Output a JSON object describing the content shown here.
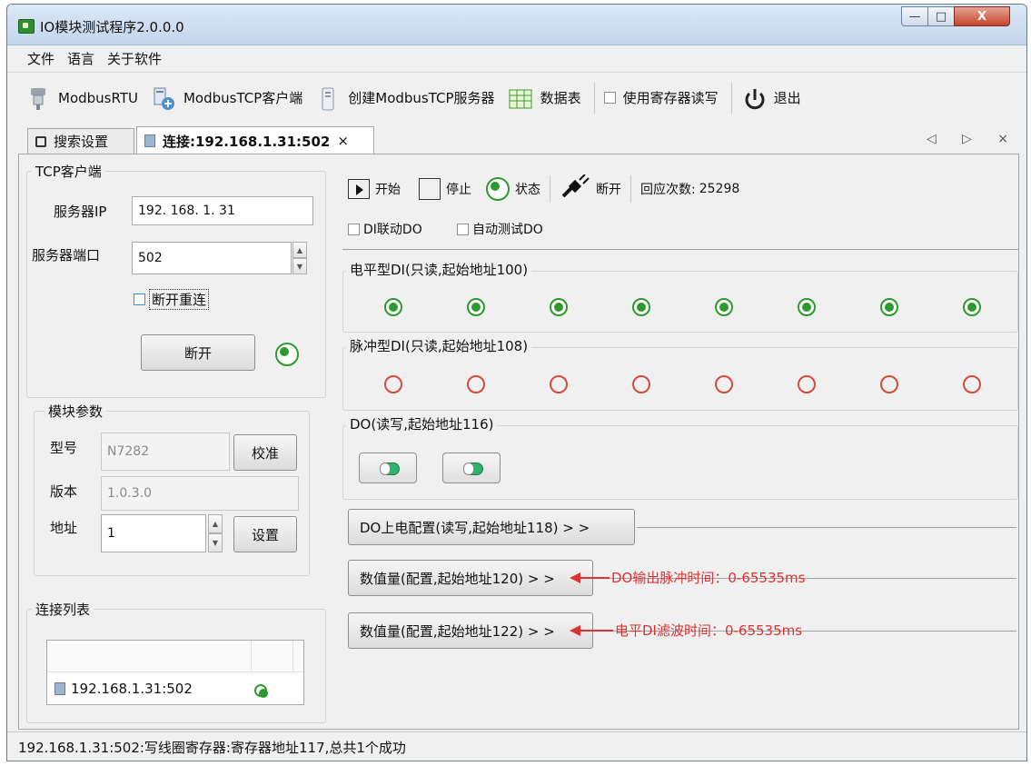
{
  "window": {
    "title": "IO模块测试程序2.0.0.0",
    "controls": {
      "minimize": "—",
      "maximize": "□",
      "close": "X"
    }
  },
  "menu": [
    "文件",
    "语言",
    "关于软件"
  ],
  "toolbar": {
    "modbus_rtu": "ModbusRTU",
    "modbus_tcp_client": "ModbusTCP客户端",
    "create_server": "创建ModbusTCP服务器",
    "data_table": "数据表",
    "use_register": "使用寄存器读写",
    "exit": "退出"
  },
  "tabs": [
    {
      "label": "搜索设置"
    },
    {
      "label": "连接:192.168.1.31:502",
      "close": "×"
    }
  ],
  "tab_nav": "◁ ▷ ×",
  "tcp_client": {
    "title": "TCP客户端",
    "server_ip_label": "服务器IP",
    "server_ip_value": "192. 168.   1.  31",
    "server_port_label": "服务器端口",
    "server_port_value": "502",
    "reconnect_label": "断开重连",
    "disconnect_button": "断开"
  },
  "module_params": {
    "title": "模块参数",
    "model_label": "型号",
    "model_value": "N7282",
    "calibrate_button": "校准",
    "version_label": "版本",
    "version_value": "1.0.3.0",
    "address_label": "地址",
    "address_value": "1",
    "set_button": "设置"
  },
  "connection_list": {
    "title": "连接列表",
    "items": [
      {
        "label": "192.168.1.31:502",
        "connected": true
      }
    ]
  },
  "controls": {
    "start": "开始",
    "stop": "停止",
    "status": "状态",
    "disconnect": "断开",
    "response_count_label": "回应次数:",
    "response_count_value": "25298",
    "di_link_do": "DI联动DO",
    "auto_test_do": "自动测试DO"
  },
  "level_di": {
    "title": "电平型DI(只读,起始地址100)",
    "states": [
      true,
      true,
      true,
      true,
      true,
      true,
      true,
      true
    ]
  },
  "pulse_di": {
    "title": "脉冲型DI(只读,起始地址108)",
    "states": [
      false,
      false,
      false,
      false,
      false,
      false,
      false,
      false
    ]
  },
  "do_group": {
    "title": "DO(读写,起始地址116)"
  },
  "do_power_config": {
    "label": "DO上电配置(读写,起始地址118) > >"
  },
  "numeric_120": {
    "label": "数值量(配置,起始地址120) > >",
    "annotation": "DO输出脉冲时间：0-65535ms"
  },
  "numeric_122": {
    "label": "数值量(配置,起始地址122) > >",
    "annotation": "电平DI滤波时间：0-65535ms"
  },
  "status_bar": "192.168.1.31:502:写线圈寄存器:寄存器地址117,总共1个成功",
  "colors": {
    "led_on": "#2e9a2e",
    "led_off": "#d44a3d",
    "annotation": "#e03232"
  }
}
